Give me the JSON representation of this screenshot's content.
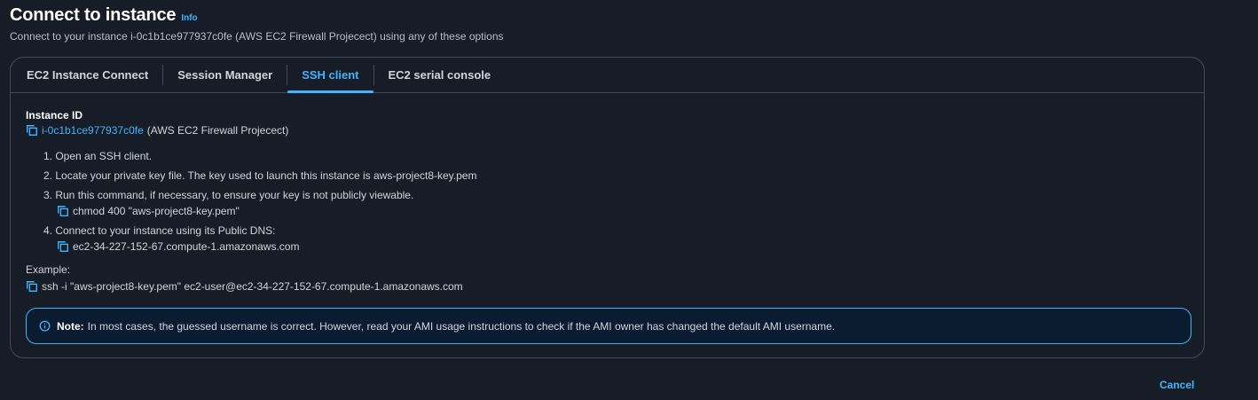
{
  "header": {
    "title": "Connect to instance",
    "info_link": "Info",
    "subtitle": "Connect to your instance i-0c1b1ce977937c0fe (AWS EC2 Firewall Projecect) using any of these options"
  },
  "tabs": [
    {
      "label": "EC2 Instance Connect",
      "active": false
    },
    {
      "label": "Session Manager",
      "active": false
    },
    {
      "label": "SSH client",
      "active": true
    },
    {
      "label": "EC2 serial console",
      "active": false
    }
  ],
  "ssh_client": {
    "instance_id_label": "Instance ID",
    "instance_id": "i-0c1b1ce977937c0fe",
    "instance_name": "(AWS EC2 Firewall Projecect)",
    "steps": [
      "1. Open an SSH client.",
      "2. Locate your private key file. The key used to launch this instance is aws-project8-key.pem",
      "3. Run this command, if necessary, to ensure your key is not publicly viewable.",
      "4. Connect to your instance using its Public DNS:"
    ],
    "chmod_command": "chmod 400 \"aws-project8-key.pem\"",
    "public_dns": "ec2-34-227-152-67.compute-1.amazonaws.com",
    "example_label": "Example:",
    "example_command": "ssh -i \"aws-project8-key.pem\" ec2-user@ec2-34-227-152-67.compute-1.amazonaws.com",
    "note_label": "Note:",
    "note_text": "In most cases, the guessed username is correct. However, read your AMI usage instructions to check if the AMI owner has changed the default AMI username."
  },
  "footer": {
    "cancel_label": "Cancel"
  },
  "colors": {
    "background": "#161d26",
    "accent": "#42b4ff",
    "border": "#414d5c",
    "note_background": "#0b1b30"
  },
  "icons": {
    "copy": "copy-icon",
    "info": "info-circle-icon"
  }
}
